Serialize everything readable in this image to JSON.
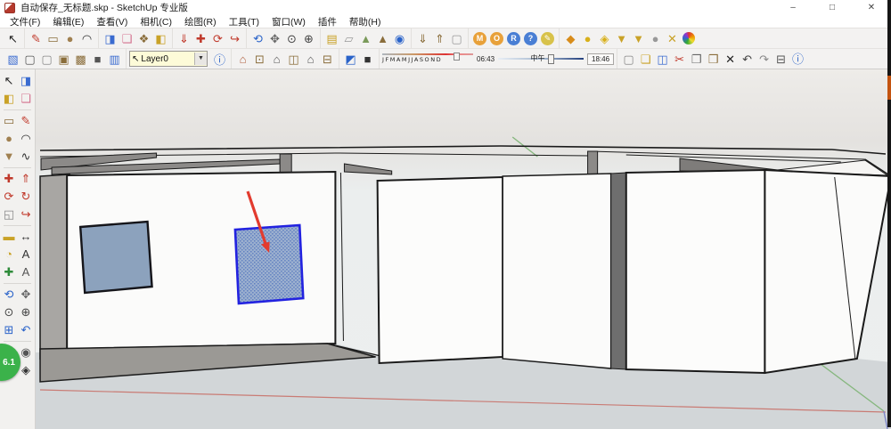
{
  "window": {
    "title": "自动保存_无标题.skp - SketchUp 专业版",
    "controls": {
      "minimize": "–",
      "maximize": "□",
      "close": "✕"
    }
  },
  "menu": {
    "items": [
      "文件(F)",
      "编辑(E)",
      "查看(V)",
      "相机(C)",
      "绘图(R)",
      "工具(T)",
      "窗口(W)",
      "插件",
      "帮助(H)"
    ]
  },
  "toolbar1": {
    "groups": [
      [
        {
          "name": "select-tool",
          "glyph": "↖",
          "color": "#222222"
        }
      ],
      [
        {
          "name": "line-tool",
          "glyph": "✎",
          "color": "#c0392b"
        },
        {
          "name": "rectangle-tool",
          "glyph": "▭",
          "color": "#8a6d3b"
        },
        {
          "name": "circle-tool",
          "glyph": "●",
          "color": "#a08050"
        },
        {
          "name": "arc-tool",
          "glyph": "◠",
          "color": "#333333"
        }
      ],
      [
        {
          "name": "pushpull-tool",
          "glyph": "◨",
          "color": "#3a6bd0"
        },
        {
          "name": "eraser-tool",
          "glyph": "❏",
          "color": "#d4718e"
        },
        {
          "name": "make-component-tool",
          "glyph": "❖",
          "color": "#8a6d3b"
        },
        {
          "name": "paint-bucket-tool",
          "glyph": "◧",
          "color": "#c9a227"
        }
      ],
      [
        {
          "name": "drop-tool",
          "glyph": "⇓",
          "color": "#c0392b"
        },
        {
          "name": "move-tool",
          "glyph": "✚",
          "color": "#c0392b"
        },
        {
          "name": "rotate-tool",
          "glyph": "⟳",
          "color": "#c0392b"
        },
        {
          "name": "offset-tool",
          "glyph": "↪",
          "color": "#c0392b"
        }
      ],
      [
        {
          "name": "orbit-tool",
          "glyph": "⟲",
          "color": "#2a63c9"
        },
        {
          "name": "pan-tool",
          "glyph": "✥",
          "color": "#666666"
        },
        {
          "name": "zoom-tool",
          "glyph": "⊙",
          "color": "#444444"
        },
        {
          "name": "zoom-extents-tool",
          "glyph": "⊕",
          "color": "#444444"
        }
      ],
      [
        {
          "name": "match-photo-icon",
          "glyph": "▤",
          "color": "#c9a227"
        },
        {
          "name": "section-plane-icon",
          "glyph": "▱",
          "color": "#999999"
        },
        {
          "name": "add-location-icon",
          "glyph": "▲",
          "color": "#7a9a5a"
        },
        {
          "name": "toggle-terrain-icon",
          "glyph": "▲",
          "color": "#8a6d3b"
        },
        {
          "name": "google-earth-icon",
          "glyph": "◉",
          "color": "#2a63c9"
        }
      ],
      [
        {
          "name": "get-models-icon",
          "glyph": "⇓",
          "color": "#8a6d3b"
        },
        {
          "name": "share-model-icon",
          "glyph": "⇑",
          "color": "#8a6d3b"
        },
        {
          "name": "component-box-icon",
          "glyph": "▢",
          "color": "#999999"
        }
      ],
      [
        {
          "name": "extension-m-badge",
          "glyph": "M",
          "color": "#e8a13a",
          "badge": true
        },
        {
          "name": "extension-o-badge",
          "glyph": "O",
          "color": "#e8a13a",
          "badge": true
        },
        {
          "name": "extension-r-badge",
          "glyph": "R",
          "color": "#4a7fd4",
          "badge": true
        },
        {
          "name": "help-badge",
          "glyph": "?",
          "color": "#4a7fd4",
          "badge": true
        },
        {
          "name": "pencil-badge",
          "glyph": "✎",
          "color": "#d8c24a",
          "badge": true
        }
      ],
      [
        {
          "name": "sandbox-from-contours-icon",
          "glyph": "◆",
          "color": "#d88c1a"
        },
        {
          "name": "sandbox-from-scratch-icon",
          "glyph": "●",
          "color": "#d8b01a"
        },
        {
          "name": "sandbox-smoove-icon",
          "glyph": "◈",
          "color": "#d8b01a"
        },
        {
          "name": "sandbox-stamp-icon",
          "glyph": "▼",
          "color": "#c9a227"
        },
        {
          "name": "sandbox-drape-icon",
          "glyph": "▼",
          "color": "#c9a227"
        },
        {
          "name": "sandbox-add-detail-icon",
          "glyph": "●",
          "color": "#999999"
        },
        {
          "name": "sandbox-flip-edge-icon",
          "glyph": "✕",
          "color": "#c9a227"
        },
        {
          "name": "color-wheel-icon",
          "wheel": true
        }
      ]
    ]
  },
  "toolbar2": {
    "styles": [
      {
        "name": "style-xray-icon",
        "glyph": "▧",
        "color": "#3a6bd0"
      },
      {
        "name": "style-wireframe-icon",
        "glyph": "▢",
        "color": "#555555"
      },
      {
        "name": "style-hidden-line-icon",
        "glyph": "▢",
        "color": "#888888"
      },
      {
        "name": "style-shaded-icon",
        "glyph": "▣",
        "color": "#8a6d3b"
      },
      {
        "name": "style-textured-icon",
        "glyph": "▩",
        "color": "#8a6d3b"
      },
      {
        "name": "style-monochrome-icon",
        "glyph": "■",
        "color": "#555555"
      },
      {
        "name": "style-back-edges-icon",
        "glyph": "▥",
        "color": "#3a6bd0"
      }
    ],
    "layer": {
      "cursor_glyph": "↖",
      "value": "Layer0",
      "arrow": "▼",
      "manager_glyph": "ⓘ"
    },
    "views": [
      {
        "name": "view-iso-icon",
        "glyph": "⌂",
        "color": "#b06040"
      },
      {
        "name": "view-top-icon",
        "glyph": "⊡",
        "color": "#8a6d3b"
      },
      {
        "name": "view-front-icon",
        "glyph": "⌂",
        "color": "#555555"
      },
      {
        "name": "view-right-icon",
        "glyph": "◫",
        "color": "#8a6d3b"
      },
      {
        "name": "view-left-icon",
        "glyph": "⌂",
        "color": "#555555"
      },
      {
        "name": "view-back-icon",
        "glyph": "⊟",
        "color": "#8a6d3b"
      }
    ],
    "shadow_icons": [
      {
        "name": "shadow-dialog-icon",
        "glyph": "◩",
        "color": "#2a63c9"
      },
      {
        "name": "shadow-toggle-icon",
        "glyph": "■",
        "color": "#333333"
      }
    ],
    "shadow": {
      "months": "JFMAMJJASOND",
      "start": "06:43",
      "noon": "中午",
      "end": "18:46"
    },
    "standard": [
      {
        "name": "new-button",
        "glyph": "▢",
        "color": "#888888"
      },
      {
        "name": "open-button",
        "glyph": "❏",
        "color": "#c9a227"
      },
      {
        "name": "save-button",
        "glyph": "◫",
        "color": "#3a6bd0"
      },
      {
        "name": "cut-button",
        "glyph": "✂",
        "color": "#c0392b"
      },
      {
        "name": "copy-button",
        "glyph": "❐",
        "color": "#666666"
      },
      {
        "name": "paste-button",
        "glyph": "❒",
        "color": "#8a6d3b"
      },
      {
        "name": "delete-button",
        "glyph": "✕",
        "color": "#222222"
      },
      {
        "name": "undo-button",
        "glyph": "↶",
        "color": "#444444"
      },
      {
        "name": "redo-button",
        "glyph": "↷",
        "color": "#888888"
      },
      {
        "name": "print-button",
        "glyph": "⊟",
        "color": "#555555"
      },
      {
        "name": "model-info-button",
        "glyph": "ⓘ",
        "color": "#2a63c9"
      }
    ]
  },
  "palette": {
    "rows": [
      [
        {
          "name": "select",
          "glyph": "↖",
          "color": "#222222"
        },
        {
          "name": "make-component",
          "glyph": "◨",
          "color": "#3a6bd0"
        }
      ],
      [
        {
          "name": "paint-bucket",
          "glyph": "◧",
          "color": "#c9a227"
        },
        {
          "name": "eraser",
          "glyph": "❏",
          "color": "#d4718e"
        }
      ],
      "sep",
      [
        {
          "name": "rectangle",
          "glyph": "▭",
          "color": "#8a6d3b"
        },
        {
          "name": "line",
          "glyph": "✎",
          "color": "#c0392b"
        }
      ],
      [
        {
          "name": "circle",
          "glyph": "●",
          "color": "#a08050"
        },
        {
          "name": "arc",
          "glyph": "◠",
          "color": "#333333"
        }
      ],
      [
        {
          "name": "polygon",
          "glyph": "▼",
          "color": "#a08050"
        },
        {
          "name": "freehand",
          "glyph": "∿",
          "color": "#333333"
        }
      ],
      "sep",
      [
        {
          "name": "move",
          "glyph": "✚",
          "color": "#c0392b"
        },
        {
          "name": "pushpull",
          "glyph": "⇑",
          "color": "#c0392b"
        }
      ],
      [
        {
          "name": "rotate",
          "glyph": "⟳",
          "color": "#c0392b"
        },
        {
          "name": "follow-me",
          "glyph": "↻",
          "color": "#c0392b"
        }
      ],
      [
        {
          "name": "scale",
          "glyph": "◱",
          "color": "#888888"
        },
        {
          "name": "offset",
          "glyph": "↪",
          "color": "#c0392b"
        }
      ],
      "sep",
      [
        {
          "name": "tape-measure",
          "glyph": "▬",
          "color": "#c9a227"
        },
        {
          "name": "dimension",
          "glyph": "↔",
          "color": "#333333"
        }
      ],
      [
        {
          "name": "protractor",
          "glyph": "◔",
          "color": "#c9a227"
        },
        {
          "name": "text",
          "glyph": "A",
          "color": "#333333"
        }
      ],
      [
        {
          "name": "axes",
          "glyph": "✚",
          "color": "#2e8b3a"
        },
        {
          "name": "3d-text",
          "glyph": "A",
          "color": "#555555"
        }
      ],
      "sep",
      [
        {
          "name": "orbit",
          "glyph": "⟲",
          "color": "#2a63c9"
        },
        {
          "name": "pan",
          "glyph": "✥",
          "color": "#666666"
        }
      ],
      [
        {
          "name": "zoom",
          "glyph": "⊙",
          "color": "#444444"
        },
        {
          "name": "zoom-extents",
          "glyph": "⊕",
          "color": "#444444"
        }
      ],
      [
        {
          "name": "zoom-window",
          "glyph": "⊞",
          "color": "#2a63c9"
        },
        {
          "name": "previous-view",
          "glyph": "↶",
          "color": "#2a63c9"
        }
      ],
      "sep",
      [
        {
          "name": "position-camera",
          "glyph": "♟",
          "color": "#555555"
        },
        {
          "name": "look-around",
          "glyph": "◉",
          "color": "#555555"
        }
      ],
      [
        {
          "name": "walk",
          "glyph": "∵",
          "color": "#333333"
        },
        {
          "name": "section-plane",
          "glyph": "◈",
          "color": "#333333"
        }
      ]
    ]
  },
  "overlay": {
    "badge_text": "6.1"
  },
  "colors": {
    "selection-blue": "#2222e0",
    "window-fill": "#8ca2bd",
    "selected-window-fill": "#9cb0cf",
    "arrow-red": "#e23b2e",
    "axis-red": "#c97b74",
    "axis-green": "#86b77e",
    "axis-blue": "#7d86c9",
    "badge-green": "#3bb24a",
    "layer-field-bg": "#fdfbd8",
    "edge-orange": "#c35310"
  }
}
